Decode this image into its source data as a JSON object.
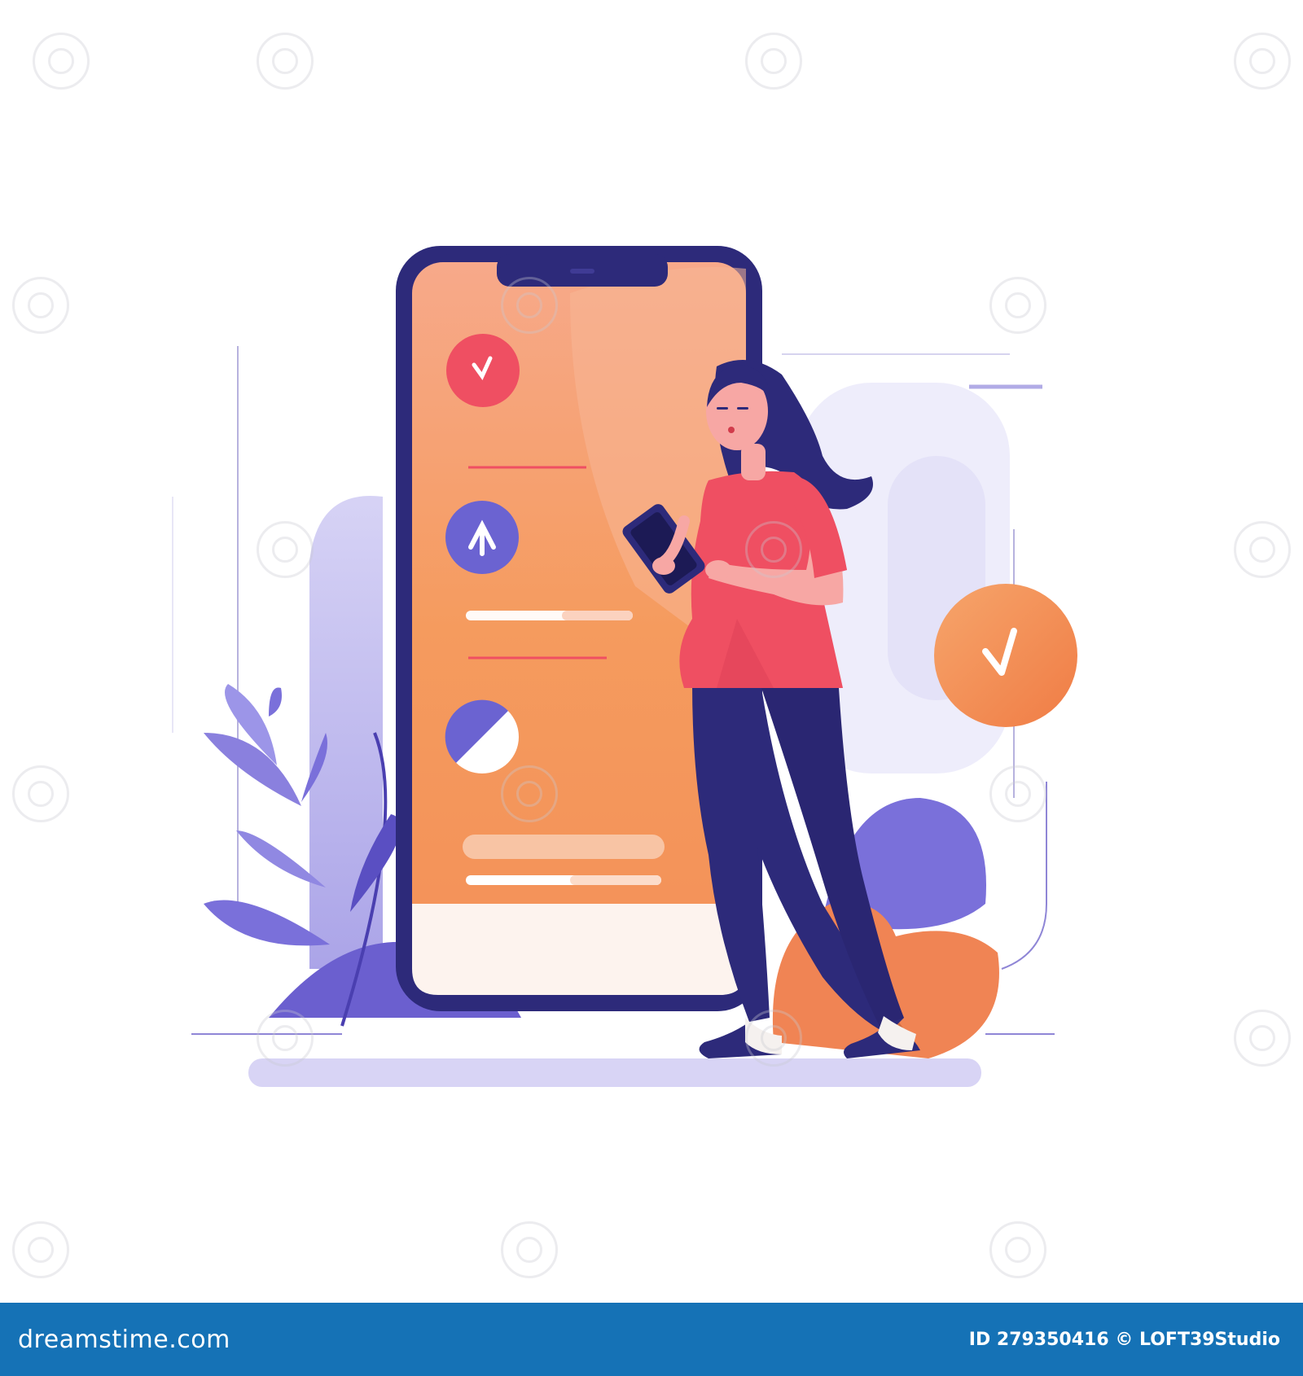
{
  "footer": {
    "brand": "dreamstime.com",
    "credit": "ID 279350416 © LOFT39Studio"
  },
  "watermark": {
    "text": "dreamstime"
  },
  "colors": {
    "phone_frame": "#2d2a7a",
    "phone_screen": "#f4a06a",
    "accent_red": "#ef4f62",
    "accent_purple": "#6b63d1",
    "accent_orange": "#f28a52",
    "footer_bg": "#1572b6"
  },
  "icons": {
    "screen_icons": [
      "check-icon",
      "arrow-up-icon",
      "half-circle-icon"
    ],
    "floating_badge": "check-icon"
  }
}
